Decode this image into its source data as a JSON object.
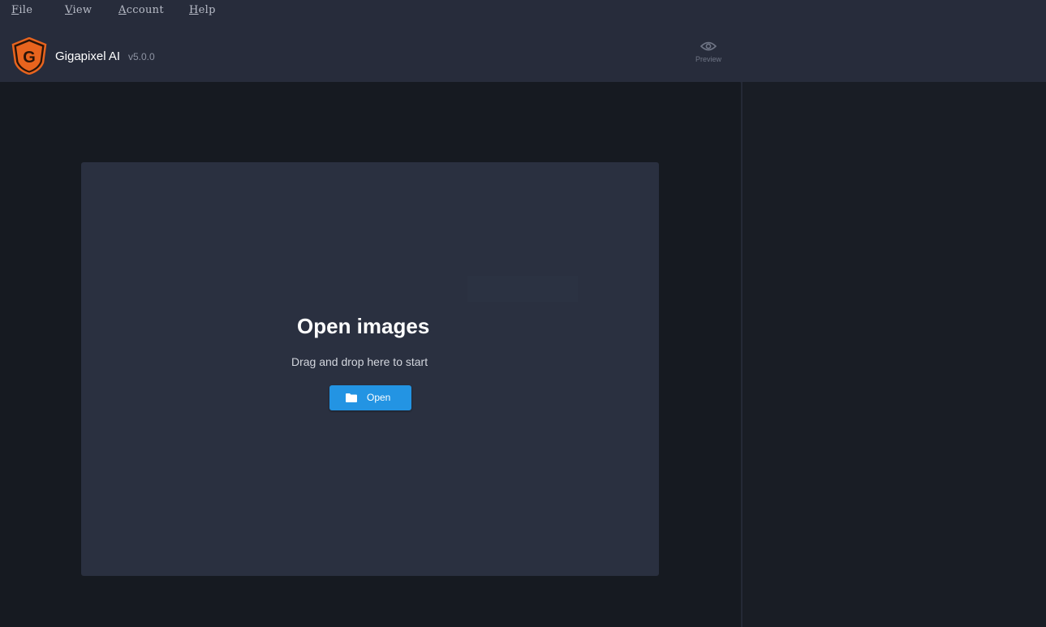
{
  "menu": {
    "items": [
      {
        "mnemonic": "F",
        "rest": "ile"
      },
      {
        "mnemonic": "V",
        "rest": "iew"
      },
      {
        "mnemonic": "A",
        "rest": "ccount"
      },
      {
        "mnemonic": "H",
        "rest": "elp"
      }
    ]
  },
  "header": {
    "logo_letter": "G",
    "app_name": "Gigapixel AI",
    "version": "v5.0.0",
    "preview_icon": "eye-icon",
    "preview_label": "Preview"
  },
  "dropzone": {
    "title": "Open images",
    "subtitle": "Drag and drop here to start",
    "open_button_label": "Open",
    "open_button_icon": "folder-icon"
  },
  "colors": {
    "accent": "#2394e3",
    "logo_orange": "#e8641e",
    "topbar": "#272c3b",
    "background": "#161a21",
    "dropzone": "#2a3040"
  }
}
